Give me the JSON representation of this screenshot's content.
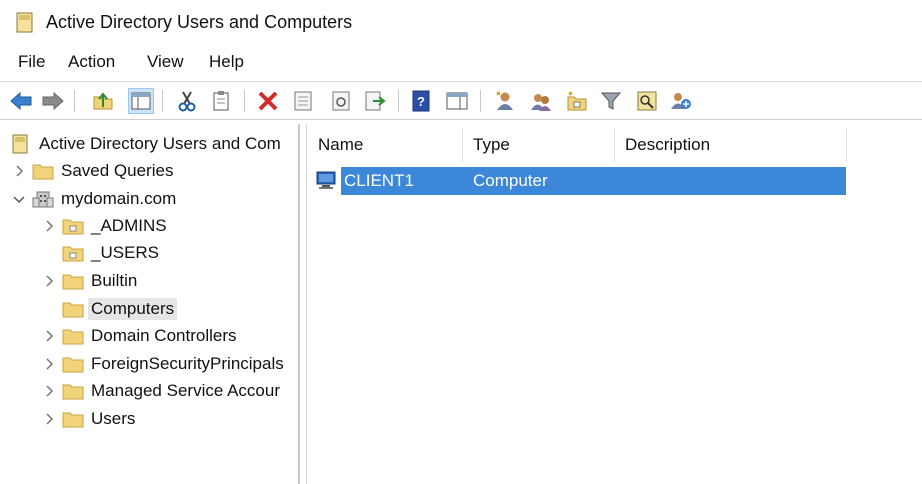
{
  "window": {
    "title": "Active Directory Users and Computers"
  },
  "menu": {
    "file": "File",
    "action": "Action",
    "view": "View",
    "help": "Help"
  },
  "toolbar": {
    "buttons": [
      "back-icon",
      "forward-icon",
      "up-folder-icon",
      "show-hide-console-tree-icon",
      "cut-icon",
      "copy-icon",
      "delete-icon",
      "properties-icon",
      "refresh-icon",
      "export-list-icon",
      "help-icon",
      "show-action-pane-icon",
      "new-user-icon",
      "new-group-icon",
      "new-ou-icon",
      "filter-icon",
      "find-icon",
      "add-to-group-icon"
    ]
  },
  "tree": {
    "root": "Active Directory Users and Com",
    "saved_queries": "Saved Queries",
    "domain": "mydomain.com",
    "children": [
      {
        "label": "_ADMINS"
      },
      {
        "label": "_USERS"
      },
      {
        "label": "Builtin"
      },
      {
        "label": "Computers"
      },
      {
        "label": "Domain Controllers"
      },
      {
        "label": "ForeignSecurityPrincipals"
      },
      {
        "label": "Managed Service Accour"
      },
      {
        "label": "Users"
      }
    ]
  },
  "list": {
    "columns": {
      "name": "Name",
      "type": "Type",
      "description": "Description"
    },
    "rows": [
      {
        "name": "CLIENT1",
        "type": "Computer",
        "description": ""
      }
    ]
  },
  "colors": {
    "selection": "#3d87d8",
    "folder": "#f1d37a",
    "accent": "#2b6fb5"
  }
}
